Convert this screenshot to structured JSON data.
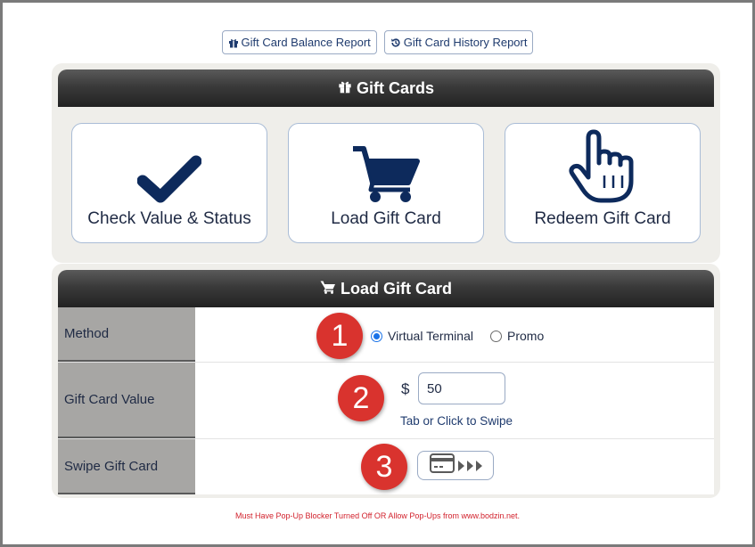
{
  "top_links": {
    "balance_report": "Gift Card Balance Report",
    "history_report": "Gift Card History Report"
  },
  "gift_cards_panel": {
    "title": "Gift Cards",
    "tiles": [
      {
        "label": "Check Value & Status",
        "icon": "checkmark-icon"
      },
      {
        "label": "Load Gift Card",
        "icon": "shopping-cart-icon"
      },
      {
        "label": "Redeem Gift Card",
        "icon": "pointing-hand-icon"
      }
    ]
  },
  "load_panel": {
    "title": "Load Gift Card",
    "method": {
      "label": "Method",
      "step": "1",
      "options": [
        "Virtual Terminal",
        "Promo"
      ],
      "selected": "Virtual Terminal"
    },
    "value": {
      "label": "Gift Card Value",
      "step": "2",
      "currency": "$",
      "amount": "50",
      "hint": "Tab or Click to Swipe"
    },
    "swipe": {
      "label": "Swipe Gift Card",
      "step": "3",
      "icon": "credit-card-swipe-icon"
    }
  },
  "footer_note": "Must Have Pop-Up Blocker Turned Off OR Allow Pop-Ups from www.bodzin.net.",
  "colors": {
    "accent_navy": "#0d2a5c",
    "badge_red": "#d9332e",
    "header_dark": "#333333",
    "warning_red": "#d2222d",
    "radio_blue": "#1a73e8"
  }
}
